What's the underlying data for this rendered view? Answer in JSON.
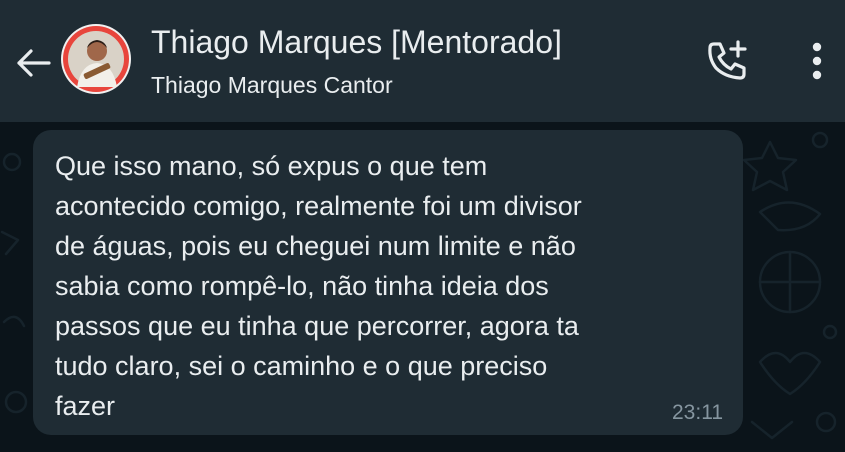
{
  "header": {
    "contact_name": "Thiago Marques [Mentorado]",
    "contact_status": "Thiago Marques Cantor",
    "icons": {
      "back": "arrow-back-icon",
      "avatar": "contact-avatar",
      "call": "add-call-icon",
      "menu": "more-vertical-icon"
    }
  },
  "chat": {
    "messages": [
      {
        "direction": "incoming",
        "text": "Que isso mano, só expus o que tem\nacontecido comigo, realmente foi um divisor\nde águas, pois eu cheguei num limite e não\nsabia como rompê-lo, não tinha ideia dos\npassos que eu tinha que percorrer, agora ta\ntudo claro, sei o caminho e o que preciso\nfazer",
        "time": "23:11"
      }
    ]
  },
  "colors": {
    "header_bg": "#1f2c34",
    "chat_bg": "#0b141a",
    "bubble_bg": "#1f2c34",
    "text_primary": "#e9edef",
    "text_secondary": "#8696a0",
    "avatar_ring": "#e8453c"
  }
}
